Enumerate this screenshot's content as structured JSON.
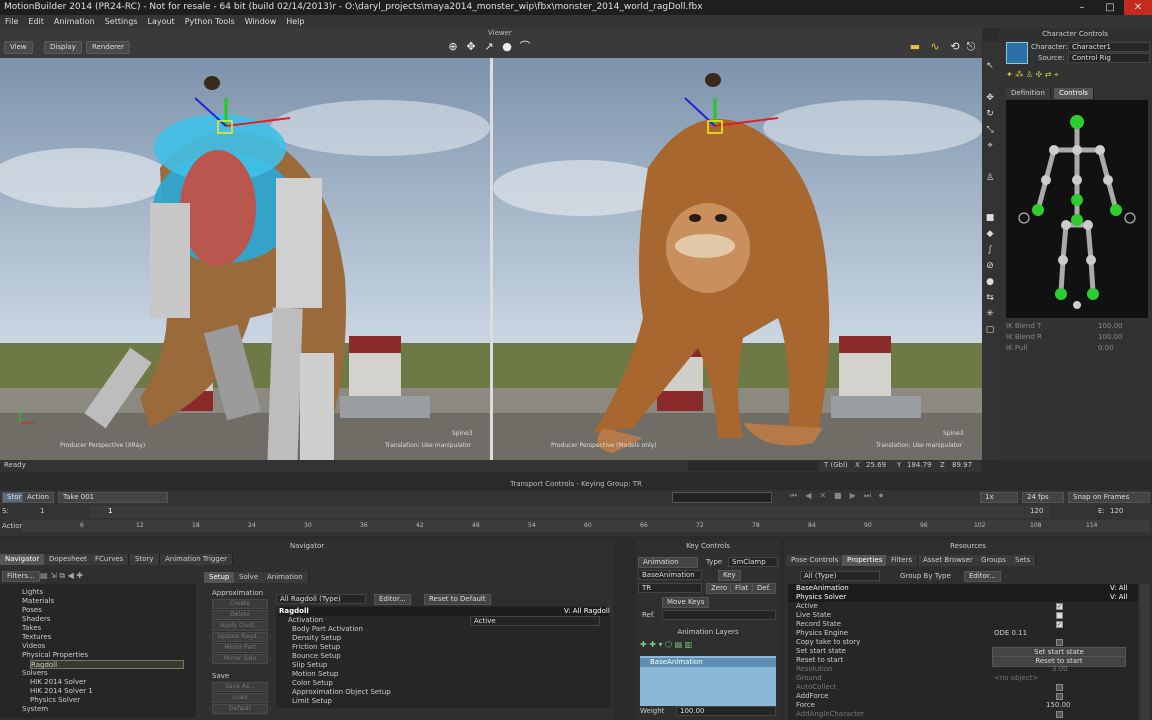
{
  "window": {
    "title": "MotionBuilder 2014 (PR24-RC)  -  Not for resale  -  64 bit (build 02/14/2013)r  -  O:\\daryl_projects\\maya2014_monster_wip\\fbx\\monster_2014_world_ragDoll.fbx",
    "controls": [
      "–",
      "□",
      "✕"
    ]
  },
  "menu": [
    "File",
    "Edit",
    "Animation",
    "Settings",
    "Layout",
    "Python Tools",
    "Window",
    "Help"
  ],
  "viewer": {
    "label": "Viewer",
    "buttons": [
      "View",
      "Display",
      "Renderer"
    ],
    "left": {
      "camera": "Producer Perspective (XRay)",
      "model": "Spine3"
    },
    "right": {
      "camera": "Producer Perspective (Models only)",
      "hint": "Translation: Use manipulator",
      "model": "Spine3"
    },
    "left_hint": "Translation: Use manipulator"
  },
  "status": {
    "text": "Ready",
    "coord_label": "T (Gbl)",
    "x_label": "X",
    "x": "25.69",
    "y_label": "Y",
    "y": "184.79",
    "z_label": "Z",
    "z": "89.97"
  },
  "character_controls": {
    "title": "Character Controls",
    "character_label": "Character:",
    "character": "Character1",
    "source_label": "Source:",
    "source": "Control Rig",
    "tabs": [
      "Definition",
      "Controls"
    ],
    "ik_rows": [
      {
        "label": "IK Blend T",
        "value": "100.00"
      },
      {
        "label": "IK Blend R",
        "value": "100.00"
      },
      {
        "label": "IK Pull",
        "value": "0.00"
      }
    ]
  },
  "transport": {
    "title": "Transport Controls  -  Keying Group: TR",
    "story": "Story",
    "action": "Action",
    "take": "Take 001",
    "speed": "1x",
    "fps": "24 fps",
    "snap": "Snap on Frames",
    "s_label": "S:",
    "s_value": "1",
    "cur_frame": "1",
    "e_label": "E:",
    "e_value": "120",
    "end_left": "120",
    "action_label": "Action",
    "ticks": [
      "6",
      "12",
      "18",
      "24",
      "30",
      "36",
      "42",
      "48",
      "54",
      "60",
      "66",
      "72",
      "78",
      "84",
      "90",
      "96",
      "102",
      "108",
      "114"
    ]
  },
  "navigator": {
    "title": "Navigator",
    "tabs": [
      "Navigator",
      "Dopesheet",
      "FCurves",
      "Story",
      "Animation Trigger"
    ],
    "filters": "Filters...",
    "tree": [
      "Lights",
      "Materials",
      "Poses",
      "Shaders",
      "Takes",
      "Textures",
      "Videos",
      "Physical Properties",
      "Ragdoll",
      "Solvers",
      "HIK 2014 Solver",
      "HIK 2014 Solver 1",
      "Physics Solver",
      "System"
    ],
    "subtabs": [
      "Setup",
      "Solve",
      "Animation"
    ],
    "approx_label": "Approximation",
    "approx_buttons": [
      "Create",
      "Delete",
      "Apply Clust...",
      "Update Ragd...",
      "Mirror Part",
      "Mirror Side"
    ],
    "save_label": "Save",
    "save_buttons": [
      "Save As...",
      "Load",
      "Default"
    ],
    "combo": "All Ragdoll (Type)",
    "editor": "Editor...",
    "reset": "Reset to Default",
    "section": "Ragdoll",
    "section_right": "V: All Ragdoll",
    "activation_label": "Activation",
    "activation_value": "Active",
    "setups": [
      "Body Part Activation",
      "Density Setup",
      "Friction Setup",
      "Bounce Setup",
      "Slip Setup",
      "Motion Setup",
      "Color Setup",
      "Approximation Object Setup",
      "Limit Setup"
    ]
  },
  "key_controls": {
    "title": "Key Controls",
    "animation": "Animation",
    "type_label": "Type",
    "type_value": "SmClamp",
    "base": "BaseAnimation",
    "key": "Key",
    "tr": "TR",
    "zero": "Zero",
    "flat": "Flat",
    "def": "Def.",
    "move_keys": "Move Keys",
    "ref_label": "Ref.",
    "layers_title": "Animation Layers",
    "layer": "BaseAnimation",
    "weight_label": "Weight",
    "weight_value": "100.00"
  },
  "resources": {
    "title": "Resources",
    "tabs": [
      "Pose Controls",
      "Properties",
      "Filters",
      "Asset Browser",
      "Groups",
      "Sets"
    ],
    "combo": "All (Type)",
    "group_by": "Group By Type",
    "editor": "Editor...",
    "sections": [
      {
        "label": "BaseAnimation",
        "right": "V: All"
      },
      {
        "label": "Physics Solver",
        "right": "V: All"
      }
    ],
    "props": [
      {
        "label": "Active",
        "value": "✓"
      },
      {
        "label": "Live State",
        "value": ""
      },
      {
        "label": "Record State",
        "value": "✓"
      },
      {
        "label": "Physics Engine",
        "value": "ODE 0.11"
      },
      {
        "label": "Copy take to story",
        "value": ""
      },
      {
        "label": "Set start state",
        "value": "Set start state"
      },
      {
        "label": "Reset to start",
        "value": "Reset to start"
      },
      {
        "label": "Resolution",
        "value": "3.00"
      },
      {
        "label": "Ground",
        "value": "<no object>"
      },
      {
        "label": "AutoCollect",
        "value": ""
      },
      {
        "label": "AddForce",
        "value": ""
      },
      {
        "label": "Force",
        "value": "150.00"
      },
      {
        "label": "AddAngleCharacter",
        "value": ""
      }
    ]
  }
}
